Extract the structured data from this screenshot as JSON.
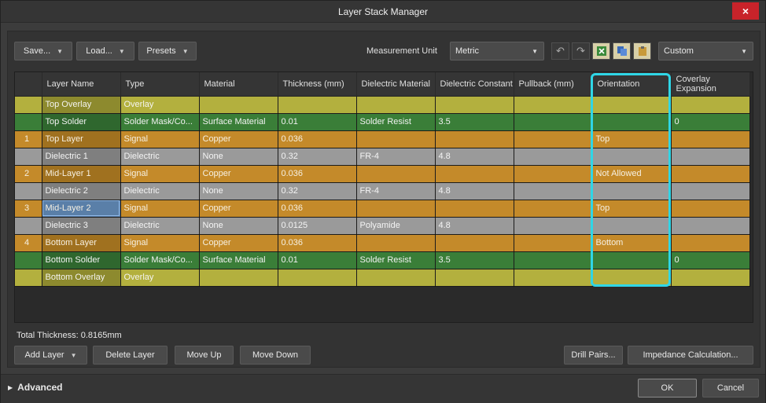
{
  "window": {
    "title": "Layer Stack Manager",
    "close": "×"
  },
  "toolbar": {
    "save": "Save...",
    "load": "Load...",
    "presets": "Presets",
    "measurement_label": "Measurement Unit",
    "measurement_value": "Metric",
    "preset_value": "Custom"
  },
  "table": {
    "headers": [
      "",
      "Layer Name",
      "Type",
      "Material",
      "Thickness (mm)",
      "Dielectric Material",
      "Dielectric Constant",
      "Pullback (mm)",
      "Orientation",
      "Coverlay Expansion"
    ],
    "rows": [
      {
        "kind": "overlay",
        "num": "",
        "name": "Top Overlay",
        "type": "Overlay",
        "material": "",
        "thickness": "",
        "dmat": "",
        "dconst": "",
        "pullback": "",
        "orientation": "",
        "coverlay": ""
      },
      {
        "kind": "solder",
        "num": "",
        "name": "Top Solder",
        "type": "Solder Mask/Co...",
        "material": "Surface Material",
        "thickness": "0.01",
        "dmat": "Solder Resist",
        "dconst": "3.5",
        "pullback": "",
        "orientation": "",
        "coverlay": "0"
      },
      {
        "kind": "signal",
        "num": "1",
        "name": "Top Layer",
        "type": "Signal",
        "material": "Copper",
        "thickness": "0.036",
        "dmat": "",
        "dconst": "",
        "pullback": "",
        "orientation": "Top",
        "coverlay": ""
      },
      {
        "kind": "dielectric",
        "num": "",
        "name": "Dielectric 1",
        "type": "Dielectric",
        "material": "None",
        "thickness": "0.32",
        "dmat": "FR-4",
        "dconst": "4.8",
        "pullback": "",
        "orientation": "",
        "coverlay": ""
      },
      {
        "kind": "signal",
        "num": "2",
        "name": "Mid-Layer 1",
        "type": "Signal",
        "material": "Copper",
        "thickness": "0.036",
        "dmat": "",
        "dconst": "",
        "pullback": "",
        "orientation": "Not Allowed",
        "coverlay": ""
      },
      {
        "kind": "dielectric",
        "num": "",
        "name": "Dielectric 2",
        "type": "Dielectric",
        "material": "None",
        "thickness": "0.32",
        "dmat": "FR-4",
        "dconst": "4.8",
        "pullback": "",
        "orientation": "",
        "coverlay": ""
      },
      {
        "kind": "signal",
        "num": "3",
        "name": "Mid-Layer 2",
        "type": "Signal",
        "material": "Copper",
        "thickness": "0.036",
        "dmat": "",
        "dconst": "",
        "pullback": "",
        "orientation": "Top",
        "coverlay": "",
        "selected": true
      },
      {
        "kind": "dielectric",
        "num": "",
        "name": "Dielectric 3",
        "type": "Dielectric",
        "material": "None",
        "thickness": "0.0125",
        "dmat": "Polyamide",
        "dconst": "4.8",
        "pullback": "",
        "orientation": "",
        "coverlay": ""
      },
      {
        "kind": "signal",
        "num": "4",
        "name": "Bottom Layer",
        "type": "Signal",
        "material": "Copper",
        "thickness": "0.036",
        "dmat": "",
        "dconst": "",
        "pullback": "",
        "orientation": "Bottom",
        "coverlay": ""
      },
      {
        "kind": "solder",
        "num": "",
        "name": "Bottom Solder",
        "type": "Solder Mask/Co...",
        "material": "Surface Material",
        "thickness": "0.01",
        "dmat": "Solder Resist",
        "dconst": "3.5",
        "pullback": "",
        "orientation": "",
        "coverlay": "0"
      },
      {
        "kind": "overlay",
        "num": "",
        "name": "Bottom Overlay",
        "type": "Overlay",
        "material": "",
        "thickness": "",
        "dmat": "",
        "dconst": "",
        "pullback": "",
        "orientation": "",
        "coverlay": ""
      }
    ]
  },
  "total_thickness": "Total Thickness: 0.8165mm",
  "actions": {
    "add_layer": "Add Layer",
    "delete_layer": "Delete Layer",
    "move_up": "Move Up",
    "move_down": "Move Down",
    "drill_pairs": "Drill Pairs...",
    "impedance": "Impedance Calculation..."
  },
  "footer": {
    "advanced": "Advanced",
    "ok": "OK",
    "cancel": "Cancel"
  },
  "colors": {
    "overlay": "#b3b03e",
    "solder": "#3a7e38",
    "signal": "#c48a2a",
    "dielectric": "#9a9a9a",
    "highlight": "#2fd6e6",
    "close": "#c8232a"
  }
}
